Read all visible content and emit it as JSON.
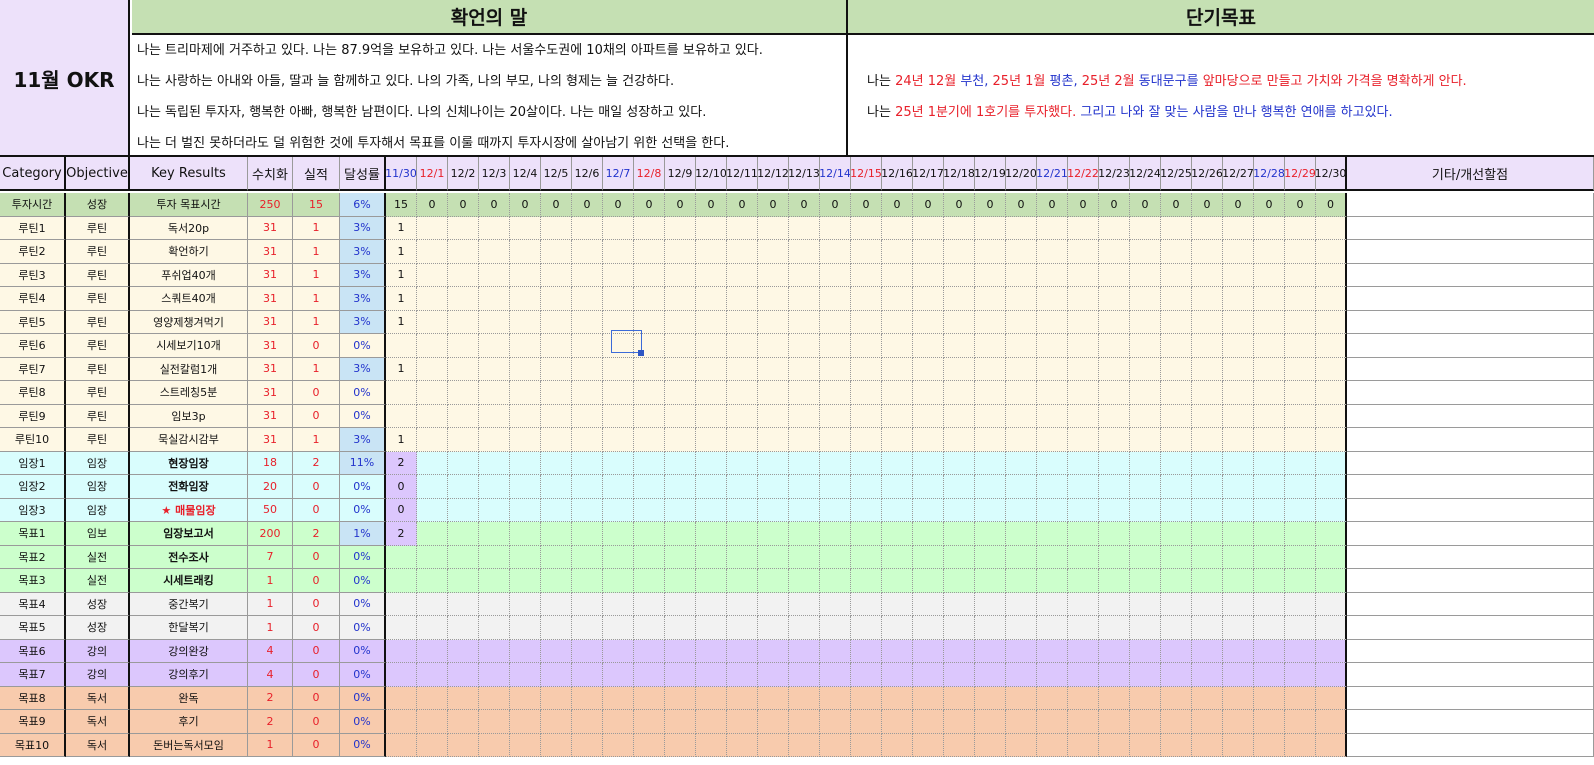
{
  "okr_title": "11월 OKR",
  "affirmation": {
    "title": "확언의 말",
    "lines": [
      "나는 트리마제에 거주하고 있다. 나는 87.9억을 보유하고 있다. 나는 서울수도권에 10채의 아파트를 보유하고 있다.",
      "나는 사랑하는 아내와 아들, 딸과 늘 함께하고 있다. 나의 가족, 나의 부모, 나의 형제는 늘 건강하다.",
      "나는 독립된 투자자, 행복한 아빠, 행복한 남편이다. 나의 신체나이는 20살이다. 나는 매일 성장하고 있다.",
      "나는 더 벌진 못하더라도 덜 위험한 것에 투자해서 목표를 이룰 때까지 투자시장에 살아남기 위한 선택을 한다."
    ]
  },
  "short_term_goal": {
    "title": "단기목표",
    "lines": [
      [
        {
          "text": "나는 ",
          "color": "black"
        },
        {
          "text": "24년 12월",
          "color": "red"
        },
        {
          "text": " 부천, ",
          "color": "blue"
        },
        {
          "text": "25년 1월",
          "color": "red"
        },
        {
          "text": " 평촌, ",
          "color": "blue"
        },
        {
          "text": "25년 2월",
          "color": "red"
        },
        {
          "text": " 동대문구를 ",
          "color": "blue"
        },
        {
          "text": "앞마당으로 만들고 가치와 가격을 명확하게 안다.",
          "color": "red"
        }
      ],
      [
        {
          "text": "나는 ",
          "color": "black"
        },
        {
          "text": "25년 1분기에 1호기를 투자했다.",
          "color": "red"
        },
        {
          "text": " 그리고 나와 잘 맞는 사람을 만나 행복한 연애를 하고있다.",
          "color": "blue"
        }
      ]
    ]
  },
  "headers": {
    "category": "Category",
    "objective": "Objective",
    "key_results": "Key Results",
    "target": "수치화",
    "actual": "실적",
    "rate": "달성률",
    "notes": "기타/개선할점",
    "dates": [
      "11/30",
      "12/1",
      "12/2",
      "12/3",
      "12/4",
      "12/5",
      "12/6",
      "12/7",
      "12/8",
      "12/9",
      "12/10",
      "12/11",
      "12/12",
      "12/13",
      "12/14",
      "12/15",
      "12/16",
      "12/17",
      "12/18",
      "12/19",
      "12/20",
      "12/21",
      "12/22",
      "12/23",
      "12/24",
      "12/25",
      "12/26",
      "12/27",
      "12/28",
      "12/29",
      "12/30"
    ],
    "date_colors": [
      "blue",
      "red",
      "black",
      "black",
      "black",
      "black",
      "black",
      "blue",
      "red",
      "black",
      "black",
      "black",
      "black",
      "black",
      "blue",
      "red",
      "black",
      "black",
      "black",
      "black",
      "black",
      "blue",
      "red",
      "black",
      "black",
      "black",
      "black",
      "black",
      "blue",
      "red",
      "black"
    ]
  },
  "colors": {
    "investment_green": "#c5e0b3",
    "routine_cream": "#fef8e5",
    "imjang_cyan": "#d9fdfd",
    "goal_green": "#ccffcc",
    "goal_gray": "#f2f2f2",
    "goal_purple": "#dcc7fd",
    "goal_orange": "#f8cbad",
    "rate_blue_fill": "#c9e4f5",
    "day_purple_fill": "#dcc7fd",
    "header_lavender": "#ede1fa",
    "text_red": "#e8202a",
    "text_blue": "#2233cc"
  },
  "rows": [
    {
      "category": "투자시간",
      "objective": "성장",
      "key_result": "투자 목표시간",
      "target": "250",
      "actual": "15",
      "rate": "6%",
      "bg": "#c5e0b3",
      "rate_fill": true,
      "days": [
        "15",
        "0",
        "0",
        "0",
        "0",
        "0",
        "0",
        "0",
        "0",
        "0",
        "0",
        "0",
        "0",
        "0",
        "0",
        "0",
        "0",
        "0",
        "0",
        "0",
        "0",
        "0",
        "0",
        "0",
        "0",
        "0",
        "0",
        "0",
        "0",
        "0",
        "0"
      ],
      "day0_fill": "#c5e0b3",
      "kr_style": "normal"
    },
    {
      "category": "루틴1",
      "objective": "루틴",
      "key_result": "독서20p",
      "target": "31",
      "actual": "1",
      "rate": "3%",
      "bg": "#fef8e5",
      "rate_fill": true,
      "days": [
        "1"
      ],
      "kr_style": "normal"
    },
    {
      "category": "루틴2",
      "objective": "루틴",
      "key_result": "확언하기",
      "target": "31",
      "actual": "1",
      "rate": "3%",
      "bg": "#fef8e5",
      "rate_fill": true,
      "days": [
        "1"
      ],
      "kr_style": "normal"
    },
    {
      "category": "루틴3",
      "objective": "루틴",
      "key_result": "푸쉬업40개",
      "target": "31",
      "actual": "1",
      "rate": "3%",
      "bg": "#fef8e5",
      "rate_fill": true,
      "days": [
        "1"
      ],
      "kr_style": "normal"
    },
    {
      "category": "루틴4",
      "objective": "루틴",
      "key_result": "스쿼트40개",
      "target": "31",
      "actual": "1",
      "rate": "3%",
      "bg": "#fef8e5",
      "rate_fill": true,
      "days": [
        "1"
      ],
      "kr_style": "normal"
    },
    {
      "category": "루틴5",
      "objective": "루틴",
      "key_result": "영양제챙겨먹기",
      "target": "31",
      "actual": "1",
      "rate": "3%",
      "bg": "#fef8e5",
      "rate_fill": true,
      "days": [
        "1"
      ],
      "kr_style": "normal"
    },
    {
      "category": "루틴6",
      "objective": "루틴",
      "key_result": "시세보기10개",
      "target": "31",
      "actual": "0",
      "rate": "0%",
      "bg": "#fef8e5",
      "rate_fill": false,
      "days": [],
      "kr_style": "normal"
    },
    {
      "category": "루틴7",
      "objective": "루틴",
      "key_result": "실전칼럼1개",
      "target": "31",
      "actual": "1",
      "rate": "3%",
      "bg": "#fef8e5",
      "rate_fill": true,
      "days": [
        "1"
      ],
      "kr_style": "normal"
    },
    {
      "category": "루틴8",
      "objective": "루틴",
      "key_result": "스트레칭5분",
      "target": "31",
      "actual": "0",
      "rate": "0%",
      "bg": "#fef8e5",
      "rate_fill": false,
      "days": [],
      "kr_style": "normal"
    },
    {
      "category": "루틴9",
      "objective": "루틴",
      "key_result": "임보3p",
      "target": "31",
      "actual": "0",
      "rate": "0%",
      "bg": "#fef8e5",
      "rate_fill": false,
      "days": [],
      "kr_style": "normal"
    },
    {
      "category": "루틴10",
      "objective": "루틴",
      "key_result": "묵실감시감부",
      "target": "31",
      "actual": "1",
      "rate": "3%",
      "bg": "#fef8e5",
      "rate_fill": true,
      "days": [
        "1"
      ],
      "kr_style": "normal"
    },
    {
      "category": "임장1",
      "objective": "임장",
      "key_result": "현장임장",
      "target": "18",
      "actual": "2",
      "rate": "11%",
      "bg": "#d9fdfd",
      "rate_fill": true,
      "days": [
        "2"
      ],
      "day0_fill": "#dcc7fd",
      "kr_style": "bold"
    },
    {
      "category": "임장2",
      "objective": "임장",
      "key_result": "전화임장",
      "target": "20",
      "actual": "0",
      "rate": "0%",
      "bg": "#d9fdfd",
      "rate_fill": false,
      "days": [
        "0"
      ],
      "day0_fill": "#dcc7fd",
      "kr_style": "bold"
    },
    {
      "category": "임장3",
      "objective": "임장",
      "key_result": "★ 매물임장",
      "target": "50",
      "actual": "0",
      "rate": "0%",
      "bg": "#d9fdfd",
      "rate_fill": false,
      "days": [
        "0"
      ],
      "day0_fill": "#dcc7fd",
      "kr_style": "bold-red"
    },
    {
      "category": "목표1",
      "objective": "임보",
      "key_result": "임장보고서",
      "target": "200",
      "actual": "2",
      "rate": "1%",
      "bg": "#ccffcc",
      "rate_fill": true,
      "days": [
        "2"
      ],
      "day0_fill": "#dcc7fd",
      "kr_style": "bold"
    },
    {
      "category": "목표2",
      "objective": "실전",
      "key_result": "전수조사",
      "target": "7",
      "actual": "0",
      "rate": "0%",
      "bg": "#ccffcc",
      "rate_fill": false,
      "days": [],
      "kr_style": "bold"
    },
    {
      "category": "목표3",
      "objective": "실전",
      "key_result": "시세트래킹",
      "target": "1",
      "actual": "0",
      "rate": "0%",
      "bg": "#ccffcc",
      "rate_fill": false,
      "days": [],
      "kr_style": "bold"
    },
    {
      "category": "목표4",
      "objective": "성장",
      "key_result": "중간복기",
      "target": "1",
      "actual": "0",
      "rate": "0%",
      "bg": "#f2f2f2",
      "rate_fill": false,
      "days": [],
      "kr_style": "normal"
    },
    {
      "category": "목표5",
      "objective": "성장",
      "key_result": "한달복기",
      "target": "1",
      "actual": "0",
      "rate": "0%",
      "bg": "#f2f2f2",
      "rate_fill": false,
      "days": [],
      "kr_style": "normal"
    },
    {
      "category": "목표6",
      "objective": "강의",
      "key_result": "강의완강",
      "target": "4",
      "actual": "0",
      "rate": "0%",
      "bg": "#dcc7fd",
      "rate_fill": false,
      "days": [],
      "kr_style": "normal"
    },
    {
      "category": "목표7",
      "objective": "강의",
      "key_result": "강의후기",
      "target": "4",
      "actual": "0",
      "rate": "0%",
      "bg": "#dcc7fd",
      "rate_fill": false,
      "days": [],
      "kr_style": "normal"
    },
    {
      "category": "목표8",
      "objective": "독서",
      "key_result": "완독",
      "target": "2",
      "actual": "0",
      "rate": "0%",
      "bg": "#f8cbad",
      "rate_fill": false,
      "days": [],
      "kr_style": "normal"
    },
    {
      "category": "목표9",
      "objective": "독서",
      "key_result": "후기",
      "target": "2",
      "actual": "0",
      "rate": "0%",
      "bg": "#f8cbad",
      "rate_fill": false,
      "days": [],
      "kr_style": "normal"
    },
    {
      "category": "목표10",
      "objective": "독서",
      "key_result": "돈버는독서모임",
      "target": "1",
      "actual": "0",
      "rate": "0%",
      "bg": "#f8cbad",
      "rate_fill": false,
      "days": [],
      "kr_style": "normal"
    }
  ]
}
